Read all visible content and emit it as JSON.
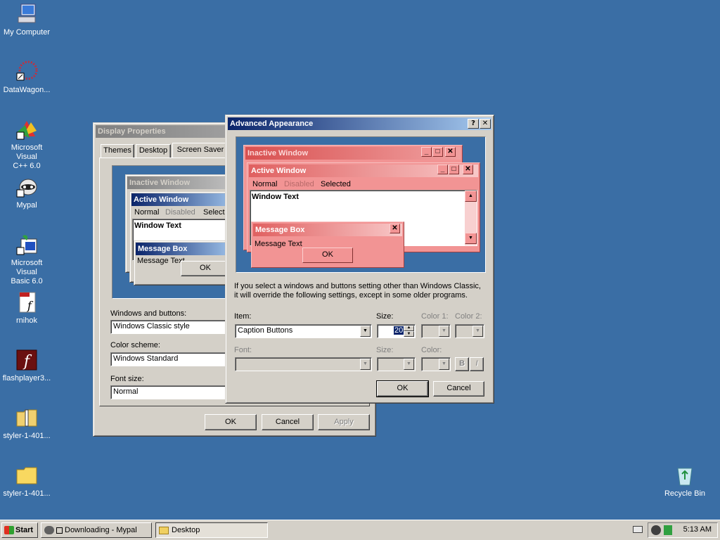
{
  "desktop": {
    "icons": [
      {
        "label1": "My Computer",
        "label2": ""
      },
      {
        "label1": "DataWagon...",
        "label2": ""
      },
      {
        "label1": "Microsoft Visual",
        "label2": "C++ 6.0"
      },
      {
        "label1": "Mypal",
        "label2": ""
      },
      {
        "label1": "Microsoft Visual",
        "label2": "Basic 6.0"
      },
      {
        "label1": "rnihok",
        "label2": ""
      },
      {
        "label1": "flashplayer3...",
        "label2": ""
      },
      {
        "label1": "styler-1-401...",
        "label2": ""
      },
      {
        "label1": "styler-1-401...",
        "label2": ""
      }
    ],
    "recycle_bin": "Recycle Bin"
  },
  "display_properties": {
    "title": "Display Properties",
    "tabs": [
      "Themes",
      "Desktop",
      "Screen Saver"
    ],
    "preview": {
      "inactive_title": "Inactive Window",
      "active_title": "Active Window",
      "menu_normal": "Normal",
      "menu_disabled": "Disabled",
      "menu_selected": "Selecte",
      "window_text": "Window Text",
      "msgbox_title": "Message Box",
      "msgbox_text": "Message Text",
      "ok": "OK"
    },
    "windows_buttons_label": "Windows and buttons:",
    "windows_buttons_value": "Windows Classic style",
    "color_scheme_label": "Color scheme:",
    "color_scheme_value": "Windows Standard",
    "font_size_label": "Font size:",
    "font_size_value": "Normal",
    "ok": "OK",
    "cancel": "Cancel",
    "apply": "Apply"
  },
  "advanced": {
    "title": "Advanced Appearance",
    "help_glyph": "?",
    "close_glyph": "✕",
    "preview": {
      "inactive_title": "Inactive Window",
      "active_title": "Active Window",
      "menu_normal": "Normal",
      "menu_disabled": "Disabled",
      "menu_selected": "Selected",
      "window_text": "Window Text",
      "msgbox_title": "Message Box",
      "msgbox_text": "Message Text",
      "ok": "OK"
    },
    "info_line1": "If you select a windows and buttons setting other than Windows Classic,",
    "info_line2": "it will override the following settings, except in some older programs.",
    "item_label": "Item:",
    "item_value": "Caption Buttons",
    "size_label": "Size:",
    "size_value": "20",
    "color1_label": "Color 1:",
    "color2_label": "Color 2:",
    "font_label": "Font:",
    "font_size_label": "Size:",
    "font_color_label": "Color:",
    "bold": "B",
    "italic": "I",
    "ok": "OK",
    "cancel": "Cancel"
  },
  "taskbar": {
    "start": "Start",
    "tasks": [
      {
        "label": "Downloading - Mypal"
      },
      {
        "label": "Desktop"
      }
    ],
    "clock": "5:13 AM"
  }
}
